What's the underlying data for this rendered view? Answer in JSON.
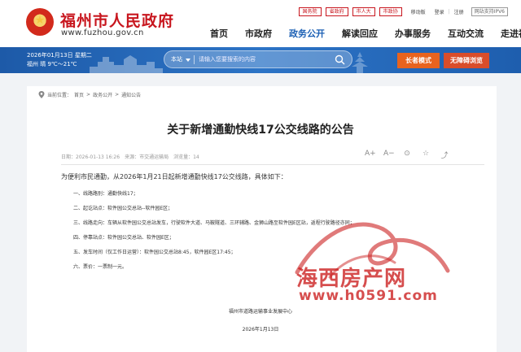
{
  "header": {
    "site_name": "福州市人民政府",
    "site_domain": "www.fuzhou.gov.cn",
    "top_links": [
      "国务院",
      "省政府",
      "市人大",
      "市政协"
    ],
    "mobile": "移动版",
    "login": "登录",
    "register": "注册",
    "ipv6": "网站支持IPV6",
    "nav": [
      "首页",
      "市政府",
      "政务公开",
      "解读回应",
      "办事服务",
      "互动交流",
      "走进福州"
    ],
    "active_nav_index": 2
  },
  "banner": {
    "date_line1": "2026年01月13日 星期二",
    "date_line2": "福州 晴 9℃～21℃",
    "search_scope": "本站",
    "search_placeholder": "请输入您要搜索的内容",
    "elder_mode": "长者模式",
    "accessibility": "无障碍浏览",
    "colors": {
      "banner": "#2465b8",
      "elder_btn": "#e8631e",
      "access_btn": "#d94d2a"
    }
  },
  "breadcrumb": {
    "prefix": "当前位置：",
    "items": [
      "首页",
      "政务公开",
      "通知公告"
    ],
    "separator": ">"
  },
  "article": {
    "title": "关于新增通勤快线17公交线路的公告",
    "date": "日期：2026-01-13 16:26",
    "source": "来源：市交通运输局",
    "views": "浏览量：14",
    "tools": [
      "A+",
      "A−",
      "⊙",
      "☆",
      "⤴"
    ],
    "intro": "为便利市民通勤，从2026年1月21日起新增通勤快线17公交线路，具体如下：",
    "items": [
      "一、线路路别：通勤快线17；",
      "二、起讫站点：软件园公交总站--软件园E区；",
      "三、线路走向：车辆从软件园公交总站发车，行驶软件大道、马鞍隧道、三环辅路、金狮山路至软件园E区站，返程行驶路径亦同；",
      "四、停靠站点：软件园公交总站、软件园E区；",
      "五、发车时间（仅工作日运营）：软件园公交总站8:45，软件园E区17:45；",
      "六、票价：一票制一元。"
    ],
    "signature": "福州市道路运输事业发展中心",
    "sign_date": "2026年1月13日"
  },
  "watermark": {
    "text": "海西房产网",
    "url": "www.h0591.com",
    "color": "#cc2222"
  }
}
